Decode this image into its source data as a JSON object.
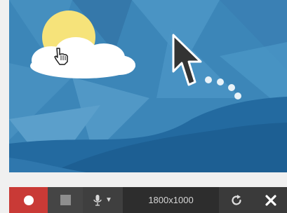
{
  "capture": {
    "scene": "sky-with-sun-cloud-and-hills",
    "icons": [
      "sun-icon",
      "cloud-icon",
      "hand-cursor-icon",
      "arrow-cursor-icon"
    ]
  },
  "toolbar": {
    "record_icon": "record-icon",
    "stop_icon": "stop-icon",
    "mic_icon": "microphone-icon",
    "dropdown_icon": "chevron-down-icon",
    "size_label": "1800x1000",
    "refresh_icon": "refresh-icon",
    "close_icon": "close-icon"
  },
  "colors": {
    "record": "#c93a36",
    "toolbar": "#3a3a3a",
    "sky": "#3c86b8",
    "hills": "#1d5f93",
    "sun": "#f6e37a"
  }
}
